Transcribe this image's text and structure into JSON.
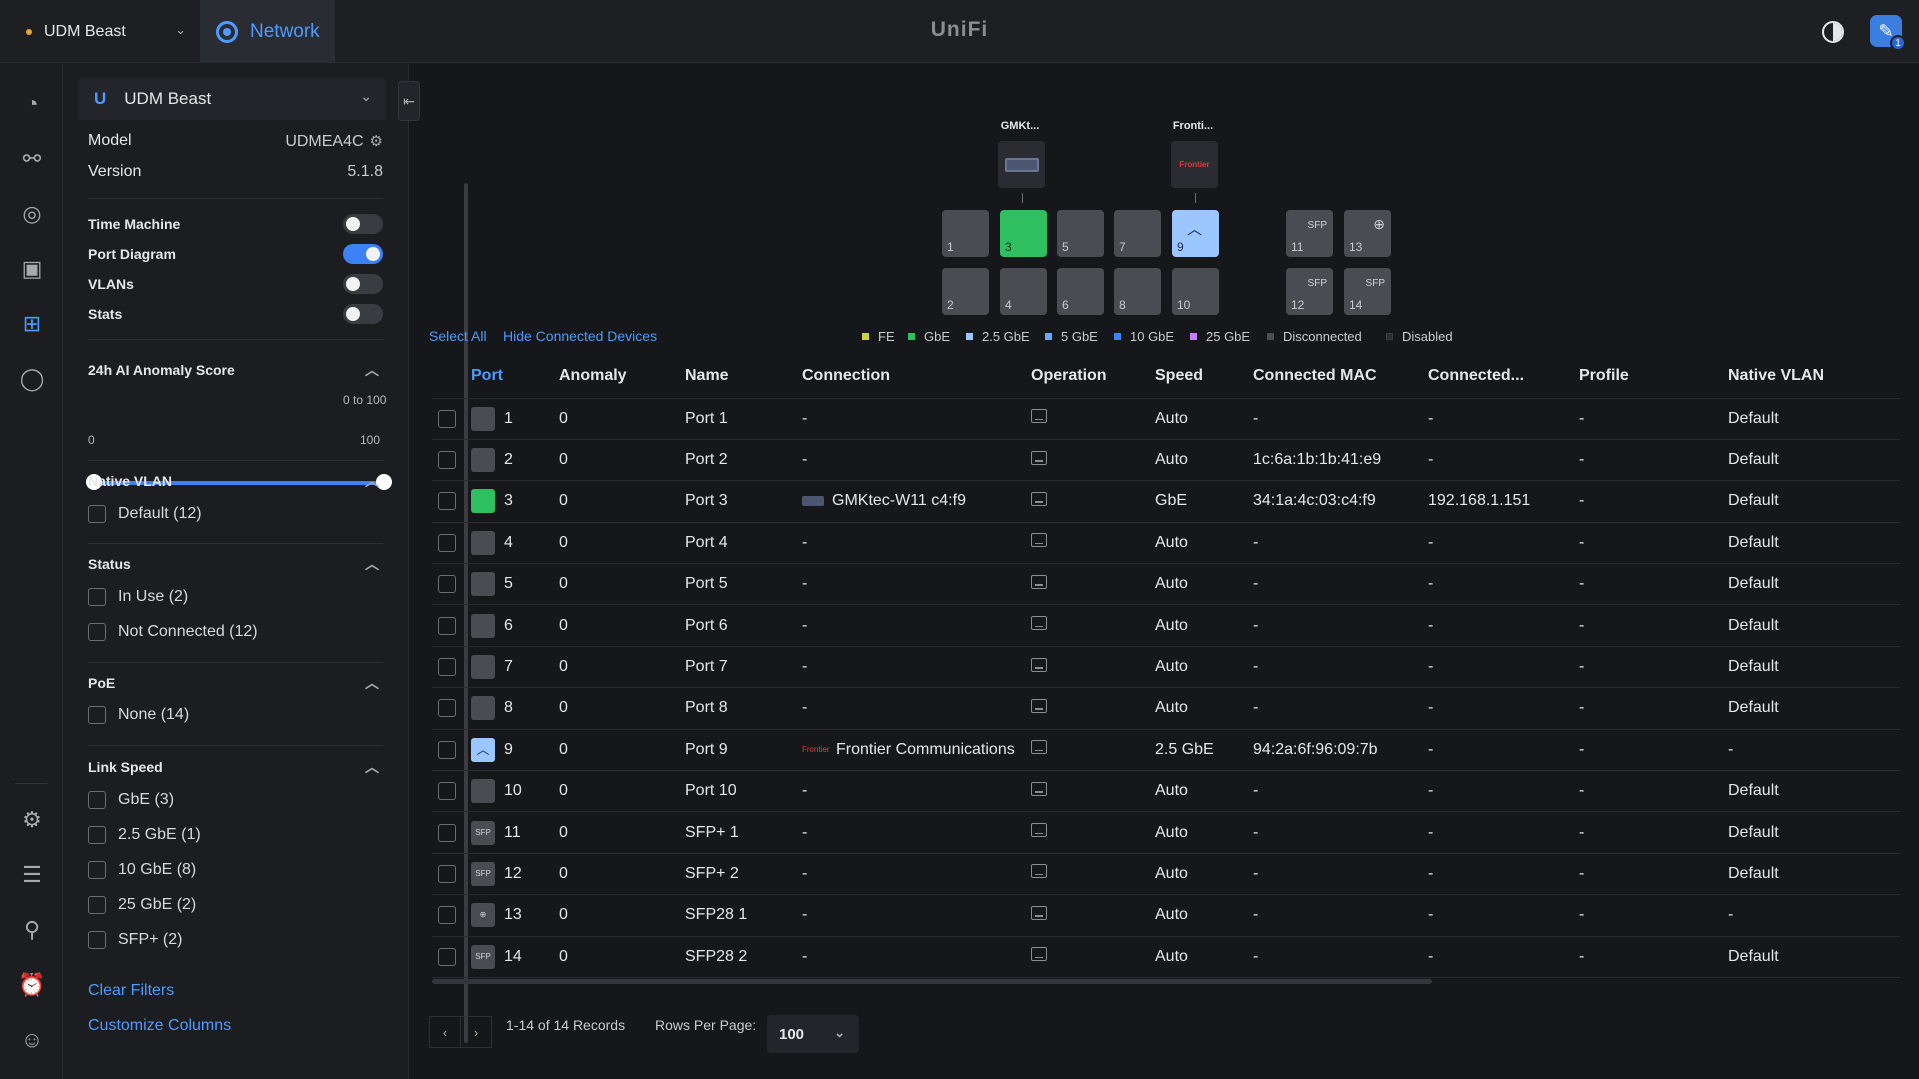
{
  "topbar": {
    "site_name": "UDM Beast",
    "app_name": "Network",
    "brand": "UniFi",
    "notification_count": "1"
  },
  "device": {
    "name": "UDM Beast",
    "model_label": "Model",
    "model_value": "UDMEA4C",
    "version_label": "Version",
    "version_value": "5.1.8"
  },
  "toggles": [
    {
      "label": "Time Machine",
      "on": false
    },
    {
      "label": "Port Diagram",
      "on": true
    },
    {
      "label": "VLANs",
      "on": false
    },
    {
      "label": "Stats",
      "on": false
    }
  ],
  "anomaly": {
    "title": "24h AI Anomaly Score",
    "range_label": "0 to 100",
    "min": "0",
    "max": "100"
  },
  "filters": {
    "native_vlan": {
      "title": "Native VLAN",
      "items": [
        "Default (12)"
      ]
    },
    "status": {
      "title": "Status",
      "items": [
        "In Use (2)",
        "Not Connected (12)"
      ]
    },
    "poe": {
      "title": "PoE",
      "items": [
        "None (14)"
      ]
    },
    "link_speed": {
      "title": "Link Speed",
      "items": [
        "GbE (3)",
        "2.5 GbE (1)",
        "10 GbE (8)",
        "25 GbE (2)",
        "SFP+ (2)"
      ]
    },
    "clear_label": "Clear Filters",
    "customize_label": "Customize Columns"
  },
  "diagram": {
    "devices": [
      {
        "label": "GMKt...",
        "thumb": "▭"
      },
      {
        "label": "Fronti...",
        "thumb": "Frontier"
      }
    ],
    "sfp_label": "SFP",
    "select_all": "Select All",
    "hide_connected": "Hide Connected Devices",
    "legend": [
      {
        "label": "FE",
        "color": "#c9d33a"
      },
      {
        "label": "GbE",
        "color": "#2fbf61"
      },
      {
        "label": "2.5 GbE",
        "color": "#9cc6ff"
      },
      {
        "label": "5 GbE",
        "color": "#6aa8ff"
      },
      {
        "label": "10 GbE",
        "color": "#3c82f6"
      },
      {
        "label": "25 GbE",
        "color": "#c77dff"
      },
      {
        "label": "Disconnected",
        "color": "#4a4c52"
      },
      {
        "label": "Disabled",
        "color": "#2a2c31"
      }
    ]
  },
  "table": {
    "headers": [
      "Port",
      "Anomaly",
      "Name",
      "Connection",
      "Operation",
      "Speed",
      "Connected MAC",
      "Connected...",
      "Profile",
      "Native VLAN"
    ],
    "rows": [
      {
        "port": "1",
        "anomaly": "0",
        "name": "Port 1",
        "connection": "-",
        "speed": "Auto",
        "mac": "-",
        "ip": "-",
        "profile": "-",
        "vlan": "Default"
      },
      {
        "port": "2",
        "anomaly": "0",
        "name": "Port 2",
        "connection": "-",
        "speed": "Auto",
        "mac": "1c:6a:1b:1b:41:e9",
        "ip": "-",
        "profile": "-",
        "vlan": "Default"
      },
      {
        "port": "3",
        "anomaly": "0",
        "name": "Port 3",
        "connection": "GMKtec-W11 c4:f9",
        "speed": "GbE",
        "mac": "34:1a:4c:03:c4:f9",
        "ip": "192.168.1.151",
        "profile": "-",
        "vlan": "Default"
      },
      {
        "port": "4",
        "anomaly": "0",
        "name": "Port 4",
        "connection": "-",
        "speed": "Auto",
        "mac": "-",
        "ip": "-",
        "profile": "-",
        "vlan": "Default"
      },
      {
        "port": "5",
        "anomaly": "0",
        "name": "Port 5",
        "connection": "-",
        "speed": "Auto",
        "mac": "-",
        "ip": "-",
        "profile": "-",
        "vlan": "Default"
      },
      {
        "port": "6",
        "anomaly": "0",
        "name": "Port 6",
        "connection": "-",
        "speed": "Auto",
        "mac": "-",
        "ip": "-",
        "profile": "-",
        "vlan": "Default"
      },
      {
        "port": "7",
        "anomaly": "0",
        "name": "Port 7",
        "connection": "-",
        "speed": "Auto",
        "mac": "-",
        "ip": "-",
        "profile": "-",
        "vlan": "Default"
      },
      {
        "port": "8",
        "anomaly": "0",
        "name": "Port 8",
        "connection": "-",
        "speed": "Auto",
        "mac": "-",
        "ip": "-",
        "profile": "-",
        "vlan": "Default"
      },
      {
        "port": "9",
        "anomaly": "0",
        "name": "Port 9",
        "connection": "Frontier Communications",
        "speed": "2.5 GbE",
        "mac": "94:2a:6f:96:09:7b",
        "ip": "-",
        "profile": "-",
        "vlan": "-"
      },
      {
        "port": "10",
        "anomaly": "0",
        "name": "Port 10",
        "connection": "-",
        "speed": "Auto",
        "mac": "-",
        "ip": "-",
        "profile": "-",
        "vlan": "Default"
      },
      {
        "port": "11",
        "anomaly": "0",
        "name": "SFP+ 1",
        "connection": "-",
        "speed": "Auto",
        "mac": "-",
        "ip": "-",
        "profile": "-",
        "vlan": "Default"
      },
      {
        "port": "12",
        "anomaly": "0",
        "name": "SFP+ 2",
        "connection": "-",
        "speed": "Auto",
        "mac": "-",
        "ip": "-",
        "profile": "-",
        "vlan": "Default"
      },
      {
        "port": "13",
        "anomaly": "0",
        "name": "SFP28 1",
        "connection": "-",
        "speed": "Auto",
        "mac": "-",
        "ip": "-",
        "profile": "-",
        "vlan": "-"
      },
      {
        "port": "14",
        "anomaly": "0",
        "name": "SFP28 2",
        "connection": "-",
        "speed": "Auto",
        "mac": "-",
        "ip": "-",
        "profile": "-",
        "vlan": "Default"
      }
    ]
  },
  "pager": {
    "records": "1-14 of 14 Records",
    "rows_label": "Rows Per Page:",
    "rows_value": "100"
  }
}
